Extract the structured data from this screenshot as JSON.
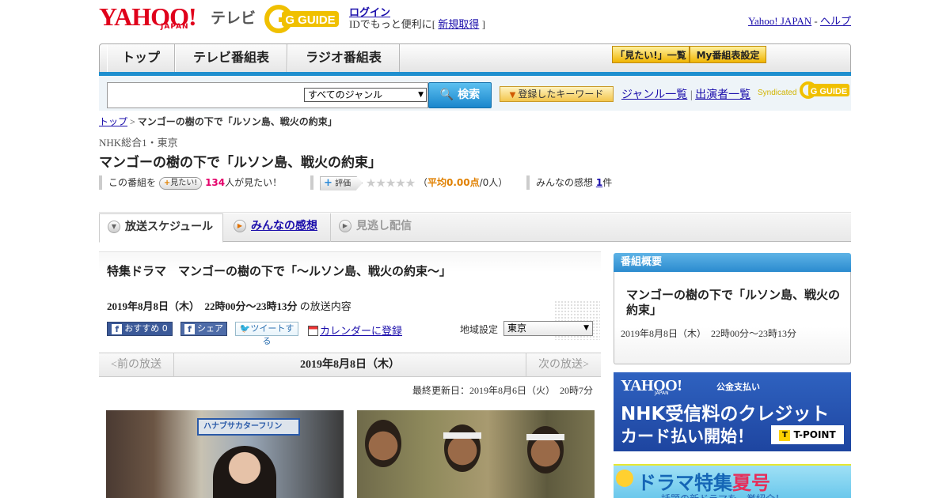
{
  "header": {
    "yahoo_logo": "YAHOO!",
    "yahoo_sub": "JAPAN",
    "tv_label": "テレビ",
    "gguide_logo": "G GUIDE",
    "login": "ログイン",
    "login_prefix": "IDでもっと便利に[ ",
    "register": "新規取得",
    "login_suffix": " ]",
    "yahoo_japan_link": "Yahoo! JAPAN",
    "sep": " - ",
    "help_link": "ヘルプ"
  },
  "nav": {
    "tabs": [
      "トップ",
      "テレビ番組表",
      "ラジオ番組表"
    ],
    "mitai_list": "「見たい!」一覧",
    "my_table": "My番組表設定"
  },
  "search": {
    "placeholder": "",
    "genre": "すべてのジャンル",
    "button": "検索",
    "keyword_button": "登録したキーワード",
    "genre_list": "ジャンル一覧",
    "divider": "|",
    "performer_list": "出演者一覧",
    "syndicated": "Syndicated",
    "synd_logo": "G GUIDE"
  },
  "breadcrumb": {
    "top": "トップ",
    "sep": " > ",
    "current": "マンゴーの樹の下で「ルソン島、戦火の約束」"
  },
  "program": {
    "channel": "NHK総合1・東京",
    "title": "マンゴーの樹の下で「ルソン島、戦火の約束」",
    "mitai_prefix": "この番組を",
    "mitai_btn": "見たい!",
    "mitai_count": "134",
    "mitai_suffix": "人が見たい！",
    "rating_btn": "評価",
    "stars": "★★★★★",
    "avg_prefix": "（",
    "avg": "平均0.00点",
    "avg_suffix": "/0人）",
    "impressions_prefix": "みんなの感想 ",
    "impressions_count": "1",
    "impressions_suffix": "件"
  },
  "tabs": {
    "schedule": "放送スケジュール",
    "reviews": "みんなの感想",
    "missed": "見逃し配信"
  },
  "detail": {
    "full_title": "特集ドラマ　マンゴーの樹の下で「～ルソン島、戦火の約束～」",
    "datetime": "2019年8月8日（木）　22時00分～23時13分",
    "datetime_suffix": " の放送内容",
    "fb_recommend": "おすすめ 0",
    "fb_share": "シェア",
    "tweet": "ツイートする",
    "calendar": "カレンダーに登録",
    "region_label": "地域設定",
    "region": "東京"
  },
  "datenav": {
    "prev": "<前の放送",
    "date": "2019年8月8日（木）",
    "next": "次の放送>"
  },
  "updated": "最終更新日：2019年8月6日（火）　20時7分",
  "photo1_sign": "ハナブサカターフリン",
  "sidebar": {
    "head": "番組概要",
    "title": "マンゴーの樹の下で「ルソン島、戦火の約束」",
    "time": "2019年8月8日（木）　22時00分～23時13分"
  },
  "ad1": {
    "logo": "YAHOO!",
    "logo_sub": "JAPAN",
    "service": "公金支払い",
    "line1": "NHK受信料のクレジット",
    "line2": "カード払い開始！",
    "tpoint": "T-POINT",
    "tpoint_mark": "T"
  },
  "ad2": {
    "title": "ドラマ特集",
    "title_red": "夏号",
    "sub": "話題の新ドラマを一挙紹介！"
  },
  "colors": {
    "nav_bar": "#1e8fcf",
    "yahoo_red": "#e0001b",
    "pink_count": "#e4006a",
    "avg_orange": "#e08000"
  }
}
